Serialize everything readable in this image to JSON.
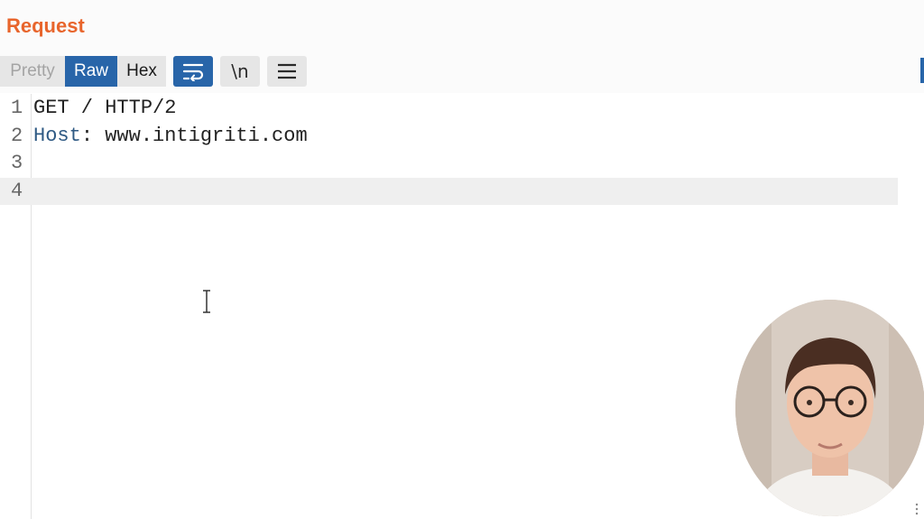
{
  "panel": {
    "title": "Request"
  },
  "view_tabs": [
    {
      "label": "Pretty",
      "state": "disabled"
    },
    {
      "label": "Raw",
      "state": "selected"
    },
    {
      "label": "Hex",
      "state": "normal"
    }
  ],
  "tools": {
    "wrap_icon": "wrap-lines-icon",
    "newline_label": "\\n",
    "menu_icon": "hamburger-menu-icon"
  },
  "editor": {
    "lines": [
      {
        "number": "1",
        "text": "GET / HTTP/2"
      },
      {
        "number": "2",
        "header_name": "Host",
        "header_value": ": www.intigriti.com"
      },
      {
        "number": "3",
        "text": ""
      },
      {
        "number": "4",
        "text": ""
      }
    ]
  },
  "colors": {
    "title": "#e8652c",
    "accent": "#2865a9",
    "header_name": "#2f5a84"
  }
}
